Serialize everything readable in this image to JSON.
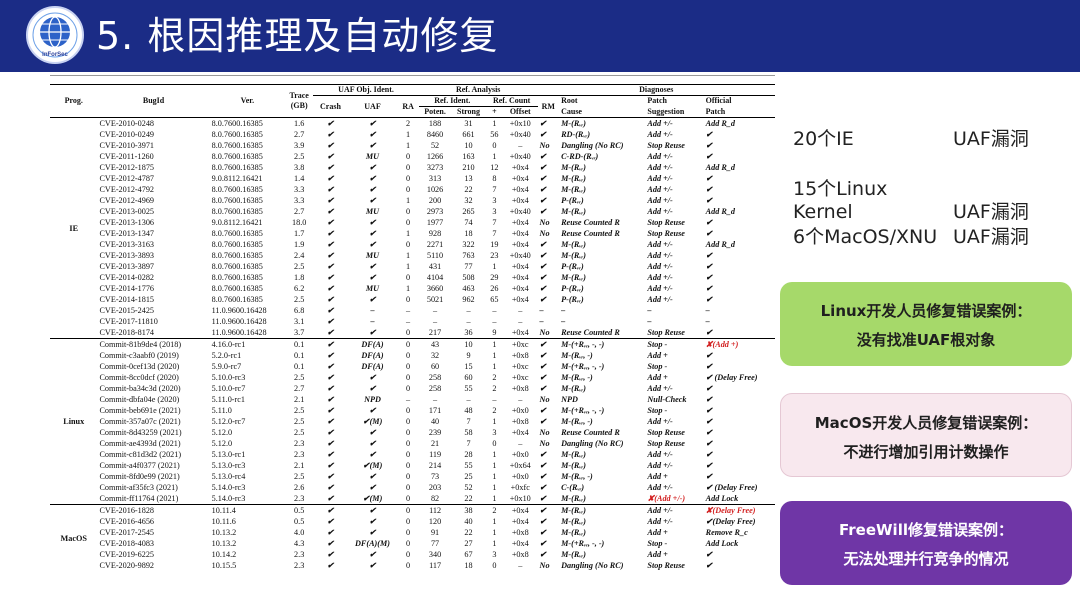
{
  "header": {
    "title": "5. 根因推理及自动修复",
    "logo_text": "InForSec"
  },
  "stats": [
    {
      "label": "20个IE",
      "value": "UAF漏洞"
    },
    {
      "label": "15个Linux Kernel",
      "value": "UAF漏洞"
    },
    {
      "label": "6个MacOS/XNU",
      "value": "UAF漏洞"
    }
  ],
  "callouts": [
    {
      "line1": "Linux开发人员修复错误案例：",
      "line2": "没有找准UAF根对象"
    },
    {
      "line1": "MacOS开发人员修复错误案例：",
      "line2": "不进行增加引用计数操作"
    },
    {
      "line1": "FreeWill修复错误案例：",
      "line2": "无法处理并行竞争的情况"
    }
  ],
  "table": {
    "group_headers": {
      "uaf": "UAF Obj. Ident.",
      "ref": "Ref. Analysis",
      "diag": "Diagnoses"
    },
    "sub_headers": {
      "ref_ident": "Ref. Ident.",
      "ref_count": "Ref. Count",
      "root": "Root",
      "patch": "Patch",
      "official": "Official"
    },
    "columns": {
      "prog": "Prog.",
      "bugid": "BugId",
      "ver": "Ver.",
      "trace": "Trace",
      "trace_unit": "(GB)",
      "crash": "Crash",
      "uaf": "UAF",
      "ra": "RA",
      "poten": "Poten.",
      "strong": "Strong",
      "plus": "+",
      "offset": "Offset",
      "rm": "RM",
      "cause": "Cause",
      "suggestion": "Suggestion",
      "patch": "Patch"
    },
    "groups": [
      {
        "prog": "IE",
        "rows": [
          [
            "CVE-2010-0248",
            "8.0.7600.16385",
            "1.6",
            "✔",
            "✔",
            "2",
            "188",
            "31",
            "1",
            "+0x10",
            "✔",
            "M-(Rᵥᵣ)",
            "Add +/-",
            "Add R_d"
          ],
          [
            "CVE-2010-0249",
            "8.0.7600.16385",
            "2.7",
            "✔",
            "✔",
            "1",
            "8460",
            "661",
            "56",
            "+0x40",
            "✔",
            "RD-(Rᵥᵣ)",
            "Add +/-",
            "✔"
          ],
          [
            "CVE-2010-3971",
            "8.0.7600.16385",
            "3.9",
            "✔",
            "✔",
            "1",
            "52",
            "10",
            "0",
            "–",
            "No",
            "Dangling (No RC)",
            "Stop Reuse",
            "✔"
          ],
          [
            "CVE-2011-1260",
            "8.0.7600.16385",
            "2.5",
            "✔",
            "MU",
            "0",
            "1266",
            "163",
            "1",
            "+0x40",
            "✔",
            "C-RD-(Rᵥᵣ)",
            "Add +/-",
            "✔"
          ],
          [
            "CVE-2012-1875",
            "8.0.7600.16385",
            "3.8",
            "✔",
            "✔",
            "0",
            "3273",
            "210",
            "12",
            "+0x4",
            "✔",
            "M-(Rᵥᵣ)",
            "Add +/-",
            "Add R_d"
          ],
          [
            "CVE-2012-4787",
            "9.0.8112.16421",
            "1.4",
            "✔",
            "✔",
            "0",
            "313",
            "13",
            "8",
            "+0x4",
            "✔",
            "M-(Rᵥᵣ)",
            "Add +/-",
            "✔"
          ],
          [
            "CVE-2012-4792",
            "8.0.7600.16385",
            "3.3",
            "✔",
            "✔",
            "0",
            "1026",
            "22",
            "7",
            "+0x4",
            "✔",
            "M-(Rᵥᵣ)",
            "Add +/-",
            "✔"
          ],
          [
            "CVE-2012-4969",
            "8.0.7600.16385",
            "3.3",
            "✔",
            "✔",
            "1",
            "200",
            "32",
            "3",
            "+0x4",
            "✔",
            "P-(Rᵥᵣ)",
            "Add +/-",
            "✔"
          ],
          [
            "CVE-2013-0025",
            "8.0.7600.16385",
            "2.7",
            "✔",
            "MU",
            "0",
            "2973",
            "265",
            "3",
            "+0x40",
            "✔",
            "M-(Rᵥᵣ)",
            "Add +/-",
            "Add R_d"
          ],
          [
            "CVE-2013-1306",
            "9.0.8112.16421",
            "18.0",
            "✔",
            "✔",
            "0",
            "1977",
            "74",
            "7",
            "+0x4",
            "No",
            "Reuse Counted R",
            "Stop Reuse",
            "✔"
          ],
          [
            "CVE-2013-1347",
            "8.0.7600.16385",
            "1.7",
            "✔",
            "✔",
            "1",
            "928",
            "18",
            "7",
            "+0x4",
            "No",
            "Reuse Counted R",
            "Stop Reuse",
            "✔"
          ],
          [
            "CVE-2013-3163",
            "8.0.7600.16385",
            "1.9",
            "✔",
            "✔",
            "0",
            "2271",
            "322",
            "19",
            "+0x4",
            "✔",
            "M-(Rᵥᵣ)",
            "Add +/-",
            "Add R_d"
          ],
          [
            "CVE-2013-3893",
            "8.0.7600.16385",
            "2.4",
            "✔",
            "MU",
            "1",
            "5110",
            "763",
            "23",
            "+0x40",
            "✔",
            "M-(Rᵥᵣ)",
            "Add +/-",
            "✔"
          ],
          [
            "CVE-2013-3897",
            "8.0.7600.16385",
            "2.5",
            "✔",
            "✔",
            "1",
            "431",
            "77",
            "1",
            "+0x4",
            "✔",
            "P-(Rᵥᵣ)",
            "Add +/-",
            "✔"
          ],
          [
            "CVE-2014-0282",
            "8.0.7600.16385",
            "1.8",
            "✔",
            "✔",
            "0",
            "4104",
            "508",
            "29",
            "+0x4",
            "✔",
            "M-(Rᵥᵣ)",
            "Add +/-",
            "✔"
          ],
          [
            "CVE-2014-1776",
            "8.0.7600.16385",
            "6.2",
            "✔",
            "MU",
            "1",
            "3660",
            "463",
            "26",
            "+0x4",
            "✔",
            "P-(Rᵥᵣ)",
            "Add +/-",
            "✔"
          ],
          [
            "CVE-2014-1815",
            "8.0.7600.16385",
            "2.5",
            "✔",
            "✔",
            "0",
            "5021",
            "962",
            "65",
            "+0x4",
            "✔",
            "P-(Rᵥᵣ)",
            "Add +/-",
            "✔"
          ],
          [
            "CVE-2015-2425",
            "11.0.9600.16428",
            "6.8",
            "✔",
            "–",
            "–",
            "–",
            "–",
            "–",
            "–",
            "–",
            "–",
            "–",
            "–"
          ],
          [
            "CVE-2017-11810",
            "11.0.9600.16428",
            "3.1",
            "✔",
            "–",
            "–",
            "–",
            "–",
            "–",
            "–",
            "–",
            "–",
            "–",
            "–"
          ],
          [
            "CVE-2018-8174",
            "11.0.9600.16428",
            "3.7",
            "✔",
            "✔",
            "0",
            "217",
            "36",
            "9",
            "+0x4",
            "No",
            "Reuse Counted R",
            "Stop Reuse",
            "✔"
          ]
        ]
      },
      {
        "prog": "Linux",
        "rows": [
          [
            "Commit-81b9de4 (2018)",
            "4.16.0-rc1",
            "0.1",
            "✔",
            "DF(A)",
            "0",
            "43",
            "10",
            "1",
            "+0xc",
            "✔",
            "M-(+Rᵥᵣ, -, -)",
            "Stop -",
            "✘(Add +)"
          ],
          [
            "Commit-c3aabf0 (2019)",
            "5.2.0-rc1",
            "0.1",
            "✔",
            "DF(A)",
            "0",
            "32",
            "9",
            "1",
            "+0x8",
            "✔",
            "M-(Rᵥᵣ, -)",
            "Add +",
            "✔"
          ],
          [
            "Commit-0cef13d (2020)",
            "5.9.0-rc7",
            "0.1",
            "✔",
            "DF(A)",
            "0",
            "60",
            "15",
            "1",
            "+0xc",
            "✔",
            "M-(+Rᵥᵣ, -, -)",
            "Stop -",
            "✔"
          ],
          [
            "Commit-8cc0dcf (2020)",
            "5.10.0-rc3",
            "2.5",
            "✔",
            "✔",
            "0",
            "258",
            "60",
            "2",
            "+0xc",
            "✔",
            "M-(Rᵥᵣ, -)",
            "Add +",
            "✔ (Delay Free)"
          ],
          [
            "Commit-ba34c3d (2020)",
            "5.10.0-rc7",
            "2.7",
            "✔",
            "✔",
            "0",
            "258",
            "55",
            "2",
            "+0x8",
            "✔",
            "M-(Rᵥᵣ)",
            "Add +/-",
            "✔"
          ],
          [
            "Commit-dbfa04e (2020)",
            "5.11.0-rc1",
            "2.1",
            "✔",
            "NPD",
            "–",
            "–",
            "–",
            "–",
            "–",
            "No",
            "NPD",
            "Null-Check",
            "✔"
          ],
          [
            "Commit-beb691e (2021)",
            "5.11.0",
            "2.5",
            "✔",
            "✔",
            "0",
            "171",
            "48",
            "2",
            "+0x0",
            "✔",
            "M-(+Rᵥᵣ, -, -)",
            "Stop -",
            "✔"
          ],
          [
            "Commit-357a07c (2021)",
            "5.12.0-rc7",
            "2.5",
            "✔",
            "✔(M)",
            "0",
            "40",
            "7",
            "1",
            "+0x8",
            "✔",
            "M-(Rᵥᵣ, -)",
            "Add +/-",
            "✔"
          ],
          [
            "Commit-8d43259 (2021)",
            "5.12.0",
            "2.5",
            "✔",
            "✔",
            "0",
            "239",
            "58",
            "3",
            "+0x4",
            "No",
            "Reuse Counted R",
            "Stop Reuse",
            "✔"
          ],
          [
            "Commit-ae4393d (2021)",
            "5.12.0",
            "2.3",
            "✔",
            "✔",
            "0",
            "21",
            "7",
            "0",
            "–",
            "No",
            "Dangling (No RC)",
            "Stop Reuse",
            "✔"
          ],
          [
            "Commit-c81d3d2 (2021)",
            "5.13.0-rc1",
            "2.3",
            "✔",
            "✔",
            "0",
            "119",
            "28",
            "1",
            "+0x0",
            "✔",
            "M-(Rᵥᵣ)",
            "Add +/-",
            "✔"
          ],
          [
            "Commit-a4f0377 (2021)",
            "5.13.0-rc3",
            "2.1",
            "✔",
            "✔(M)",
            "0",
            "214",
            "55",
            "1",
            "+0x64",
            "✔",
            "M-(Rᵥᵣ)",
            "Add +/-",
            "✔"
          ],
          [
            "Commit-8fd0e99 (2021)",
            "5.13.0-rc4",
            "2.5",
            "✔",
            "✔",
            "0",
            "73",
            "25",
            "1",
            "+0x0",
            "✔",
            "M-(Rᵥᵣ, -)",
            "Add +",
            "✔"
          ],
          [
            "Commit-af35fc3 (2021)",
            "5.14.0-rc3",
            "2.6",
            "✔",
            "✔",
            "0",
            "203",
            "52",
            "1",
            "+0xfc",
            "✔",
            "C-(Rᵥᵣ)",
            "Add +/-",
            "✔ (Delay Free)"
          ],
          [
            "Commit-ff11764 (2021)",
            "5.14.0-rc3",
            "2.3",
            "✔",
            "✔(M)",
            "0",
            "82",
            "22",
            "1",
            "+0x10",
            "✔",
            "M-(Rᵥᵣ)",
            "✘(Add +/-)",
            "Add Lock"
          ]
        ]
      },
      {
        "prog": "MacOS",
        "rows": [
          [
            "CVE-2016-1828",
            "10.11.4",
            "0.5",
            "✔",
            "✔",
            "0",
            "112",
            "38",
            "2",
            "+0x4",
            "✔",
            "M-(Rᵥᵣ)",
            "Add +/-",
            "✘(Delay Free)"
          ],
          [
            "CVE-2016-4656",
            "10.11.6",
            "0.5",
            "✔",
            "✔",
            "0",
            "120",
            "40",
            "1",
            "+0x4",
            "✔",
            "M-(Rᵥᵣ)",
            "Add +/-",
            "✔(Delay Free)"
          ],
          [
            "CVE-2017-2545",
            "10.13.2",
            "4.0",
            "✔",
            "✔",
            "0",
            "91",
            "22",
            "1",
            "+0x8",
            "✔",
            "M-(Rᵥᵣ)",
            "Add +",
            "Remove R_c"
          ],
          [
            "CVE-2018-4083",
            "10.13.2",
            "4.3",
            "✔",
            "DF(A)(M)",
            "0",
            "77",
            "27",
            "1",
            "+0x4",
            "✔",
            "M-(+Rᵥᵣ, -, -)",
            "Stop -",
            "Add Lock"
          ],
          [
            "CVE-2019-6225",
            "10.14.2",
            "2.3",
            "✔",
            "✔",
            "0",
            "340",
            "67",
            "3",
            "+0x8",
            "✔",
            "M-(Rᵥᵣ)",
            "Add +",
            "✔"
          ],
          [
            "CVE-2020-9892",
            "10.15.5",
            "2.3",
            "✔",
            "✔",
            "0",
            "117",
            "18",
            "0",
            "–",
            "No",
            "Dangling (No RC)",
            "Stop Reuse",
            "✔"
          ]
        ]
      }
    ]
  }
}
